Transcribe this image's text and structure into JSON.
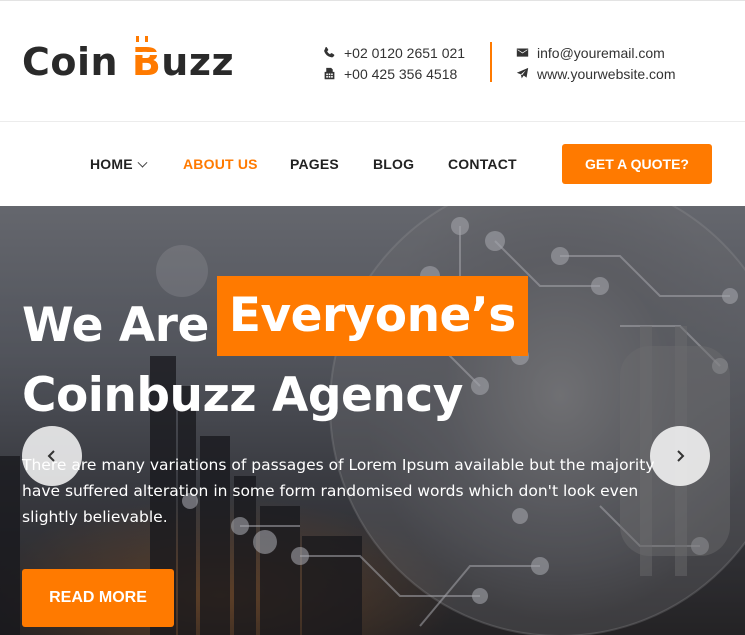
{
  "brand": {
    "part1": "Coin ",
    "b_letter": "B",
    "part2": "uzz"
  },
  "contacts": {
    "phone1": "+02 0120 2651 021",
    "phone2": "+00 425 356 4518",
    "email": "info@youremail.com",
    "website": "www.yourwebsite.com",
    "icons": [
      "phone-icon",
      "fax-icon",
      "envelope-icon",
      "paper-plane-icon"
    ]
  },
  "nav": {
    "items": [
      {
        "label": "HOME",
        "has_dropdown": true
      },
      {
        "label": "ABOUT US",
        "active": true
      },
      {
        "label": "PAGES"
      },
      {
        "label": "BLOG"
      },
      {
        "label": "CONTACT"
      }
    ],
    "cta": "GET A QUOTE?"
  },
  "hero": {
    "line1_prefix": "We Are",
    "line1_highlight": "Everyone’s",
    "line2": "Coinbuzz Agency",
    "text": "There are many variations of passages of Lorem Ipsum available but the majority have suffered alteration in some form randomised words which don't look even slightly believable.",
    "button": "READ MORE"
  },
  "colors": {
    "accent": "#ff7a00",
    "text": "#222222",
    "white": "#ffffff"
  }
}
